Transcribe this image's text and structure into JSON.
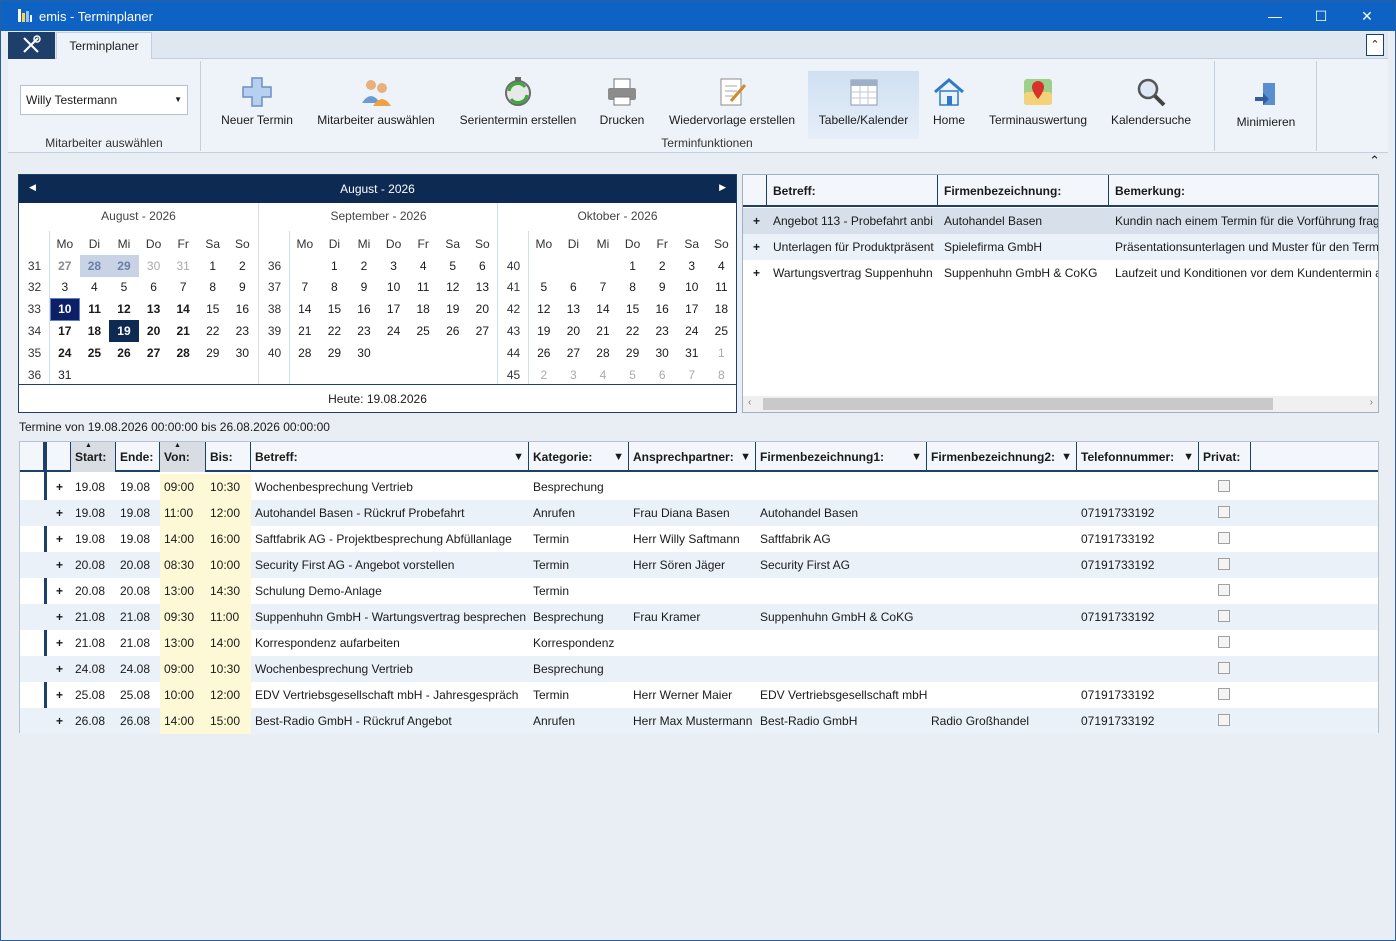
{
  "window": {
    "title": "emis - Terminplaner"
  },
  "ribbon_tabs": {
    "active": "Terminplaner"
  },
  "ribbon": {
    "employee_select": {
      "value": "Willy Testermann",
      "group_label": "Mitarbeiter auswählen"
    },
    "functions_group_label": "Terminfunktionen",
    "buttons": [
      {
        "label": "Neuer Termin",
        "icon": "plus-icon"
      },
      {
        "label": "Mitarbeiter auswählen",
        "icon": "people-icon"
      },
      {
        "label": "Serientermin erstellen",
        "icon": "recurring-clock-icon"
      },
      {
        "label": "Drucken",
        "icon": "printer-icon"
      },
      {
        "label": "Wiedervorlage erstellen",
        "icon": "notepad-pen-icon"
      },
      {
        "label": "Tabelle/Kalender",
        "icon": "calendar-table-icon"
      },
      {
        "label": "Home",
        "icon": "home-icon"
      },
      {
        "label": "Terminauswertung",
        "icon": "map-pin-icon"
      },
      {
        "label": "Kalendersuche",
        "icon": "magnifier-icon"
      }
    ],
    "minimize_label": "Minimieren"
  },
  "calendar": {
    "header": "August - 2026",
    "weekdays": [
      "Mo",
      "Di",
      "Mi",
      "Do",
      "Fr",
      "Sa",
      "So"
    ],
    "months": [
      {
        "name": "August - 2026",
        "rows": [
          [
            "31",
            "27",
            "28",
            "29",
            "30",
            "31",
            "1",
            "2"
          ],
          [
            "32",
            "3",
            "4",
            "5",
            "6",
            "7",
            "8",
            "9"
          ],
          [
            "33",
            "10",
            "11",
            "12",
            "13",
            "14",
            "15",
            "16"
          ],
          [
            "34",
            "17",
            "18",
            "19",
            "20",
            "21",
            "22",
            "23"
          ],
          [
            "35",
            "24",
            "25",
            "26",
            "27",
            "28",
            "29",
            "30"
          ],
          [
            "36",
            "31",
            "",
            "",
            "",
            "",
            "",
            ""
          ]
        ]
      },
      {
        "name": "September - 2026",
        "rows": [
          [
            "36",
            "",
            "1",
            "2",
            "3",
            "4",
            "5",
            "6"
          ],
          [
            "37",
            "7",
            "8",
            "9",
            "10",
            "11",
            "12",
            "13"
          ],
          [
            "38",
            "14",
            "15",
            "16",
            "17",
            "18",
            "19",
            "20"
          ],
          [
            "39",
            "21",
            "22",
            "23",
            "24",
            "25",
            "26",
            "27"
          ],
          [
            "40",
            "28",
            "29",
            "30",
            "",
            "",
            "",
            ""
          ],
          [
            "",
            "",
            "",
            "",
            "",
            "",
            "",
            ""
          ]
        ]
      },
      {
        "name": "Oktober - 2026",
        "rows": [
          [
            "40",
            "",
            "",
            "",
            "1",
            "2",
            "3",
            "4"
          ],
          [
            "41",
            "5",
            "6",
            "7",
            "8",
            "9",
            "10",
            "11"
          ],
          [
            "42",
            "12",
            "13",
            "14",
            "15",
            "16",
            "17",
            "18"
          ],
          [
            "43",
            "19",
            "20",
            "21",
            "22",
            "23",
            "24",
            "25"
          ],
          [
            "44",
            "26",
            "27",
            "28",
            "29",
            "30",
            "31",
            "1"
          ],
          [
            "45",
            "2",
            "3",
            "4",
            "5",
            "6",
            "7",
            "8"
          ]
        ]
      }
    ],
    "today_label": "Heute: 19.08.2026"
  },
  "reminders": {
    "headers": [
      "Betreff:",
      "Firmenbezeichnung:",
      "Bemerkung:"
    ],
    "rows": [
      [
        "Angebot 113 - Probefahrt anbi",
        "Autohandel Basen",
        "Kundin nach einem Termin für die Vorführung frag"
      ],
      [
        "Unterlagen für Produktpräsent",
        "Spielefirma GmbH",
        "Präsentationsunterlagen und Muster für den Term"
      ],
      [
        "Wartungsvertrag Suppenhuhn",
        "Suppenhuhn GmbH & CoKG",
        "Laufzeit und Konditionen vor dem Kundentermin a"
      ]
    ]
  },
  "range_label": "Termine von 19.08.2026 00:00:00 bis 26.08.2026 00:00:00",
  "appointments": {
    "headers": [
      "Start:",
      "Ende:",
      "Von:",
      "Bis:",
      "Betreff:",
      "Kategorie:",
      "Ansprechpartner:",
      "Firmenbezeichnung1:",
      "Firmenbezeichnung2:",
      "Telefonnummer:",
      "Privat:"
    ],
    "rows": [
      [
        "19.08",
        "19.08",
        "09:00",
        "10:30",
        "Wochenbesprechung Vertrieb",
        "Besprechung",
        "",
        "",
        "",
        ""
      ],
      [
        "19.08",
        "19.08",
        "11:00",
        "12:00",
        "Autohandel Basen - Rückruf Probefahrt",
        "Anrufen",
        "Frau Diana Basen",
        "Autohandel Basen",
        "",
        "07191733192"
      ],
      [
        "19.08",
        "19.08",
        "14:00",
        "16:00",
        "Saftfabrik AG - Projektbesprechung Abfüllanlage",
        "Termin",
        "Herr Willy Saftmann",
        "Saftfabrik AG",
        "",
        "07191733192"
      ],
      [
        "20.08",
        "20.08",
        "08:30",
        "10:00",
        "Security First AG - Angebot vorstellen",
        "Termin",
        "Herr Sören Jäger",
        "Security First AG",
        "",
        "07191733192"
      ],
      [
        "20.08",
        "20.08",
        "13:00",
        "14:30",
        "Schulung Demo-Anlage",
        "Termin",
        "",
        "",
        "",
        ""
      ],
      [
        "21.08",
        "21.08",
        "09:30",
        "11:00",
        "Suppenhuhn GmbH - Wartungsvertrag besprechen",
        "Besprechung",
        "Frau Kramer",
        "Suppenhuhn GmbH & CoKG",
        "",
        "07191733192"
      ],
      [
        "21.08",
        "21.08",
        "13:00",
        "14:00",
        "Korrespondenz aufarbeiten",
        "Korrespondenz",
        "",
        "",
        "",
        ""
      ],
      [
        "24.08",
        "24.08",
        "09:00",
        "10:30",
        "Wochenbesprechung Vertrieb",
        "Besprechung",
        "",
        "",
        "",
        ""
      ],
      [
        "25.08",
        "25.08",
        "10:00",
        "12:00",
        "EDV Vertriebsgesellschaft mbH - Jahresgespräch",
        "Termin",
        "Herr Werner Maier",
        "EDV Vertriebsgesellschaft mbH",
        "",
        "07191733192"
      ],
      [
        "26.08",
        "26.08",
        "14:00",
        "15:00",
        "Best-Radio GmbH - Rückruf Angebot",
        "Anrufen",
        "Herr Max Mustermann",
        "Best-Radio GmbH",
        "Radio Großhandel",
        "07191733192"
      ]
    ]
  },
  "colors": {
    "titlebar": "#0e62c4",
    "calendar_header": "#0d2a52",
    "time_highlight": "#fdf9d6",
    "row_alt": "#eaf1f9"
  }
}
